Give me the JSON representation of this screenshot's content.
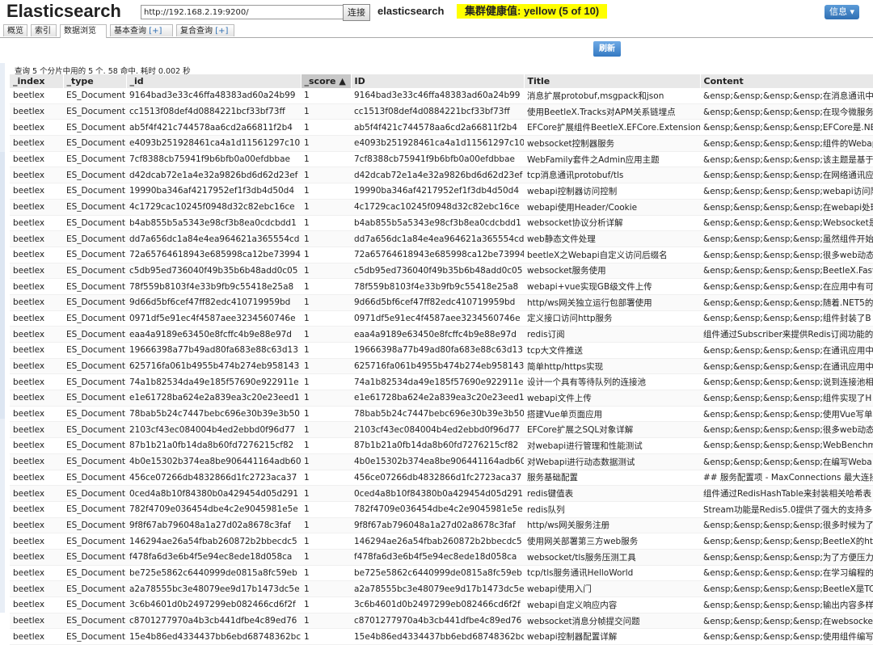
{
  "header": {
    "app_title": "Elasticsearch",
    "url": "http://192.168.2.19:9200/",
    "connect_label": "连接",
    "cluster_name": "elasticsearch",
    "health_label": "集群健康值: yellow (5 of 10)",
    "info_label": "信息 ▾"
  },
  "tabs": [
    {
      "label": "概览",
      "plus": ""
    },
    {
      "label": "索引",
      "plus": ""
    },
    {
      "label": "数据浏览",
      "plus": ""
    },
    {
      "label": "基本查询 ",
      "plus": "[+]"
    },
    {
      "label": "复合查询 ",
      "plus": "[+]"
    }
  ],
  "toolbar": {
    "refresh_label": "刷新"
  },
  "query_summary": "查询 5 个分片中用的 5 个. 58 命中. 耗时 0.002 秒",
  "columns": [
    "_index",
    "_type",
    "_id",
    "_score ▲",
    "ID",
    "Title",
    "Content"
  ],
  "rows": [
    [
      "beetlex",
      "ES_Document",
      "9164bad3e33c46ffa48383ad60a24b99",
      "1",
      "9164bad3e33c46ffa48383ad60a24b99",
      "消息扩展protobuf,msgpack和json",
      "&ensp;&ensp;&ensp;&ensp;在消息通讯中"
    ],
    [
      "beetlex",
      "ES_Document",
      "cc1513f08def4d0884221bcf33bf73ff",
      "1",
      "cc1513f08def4d0884221bcf33bf73ff",
      "使用BeetleX.Tracks对APM关系链埋点",
      "&ensp;&ensp;&ensp;&ensp;在现今微服务"
    ],
    [
      "beetlex",
      "ES_Document",
      "ab5f4f421c744578aa6cd2a66811f2b4",
      "1",
      "ab5f4f421c744578aa6cd2a66811f2b4",
      "EFCore扩展组件BeetleX.EFCore.Extension",
      "&ensp;&ensp;&ensp;&ensp;EFCore是.NE"
    ],
    [
      "beetlex",
      "ES_Document",
      "e4093b251928461ca4a1d11561297c10",
      "1",
      "e4093b251928461ca4a1d11561297c10",
      "websocket控制器服务",
      "&ensp;&ensp;&ensp;&ensp;组件的Webapi"
    ],
    [
      "beetlex",
      "ES_Document",
      "7cf8388cb75941f9b6bfb0a00efdbbae",
      "1",
      "7cf8388cb75941f9b6bfb0a00efdbbae",
      "WebFamily套件之Admin应用主题",
      "&ensp;&ensp;&ensp;&ensp;该主题是基于"
    ],
    [
      "beetlex",
      "ES_Document",
      "d42dcab72e1a4e32a9826bd6d62d23ef",
      "1",
      "d42dcab72e1a4e32a9826bd6d62d23ef",
      "tcp消息通讯protobuf/tls",
      "&ensp;&ensp;&ensp;&ensp;在网络通讯应"
    ],
    [
      "beetlex",
      "ES_Document",
      "19990ba346af4217952ef1f3db4d50d4",
      "1",
      "19990ba346af4217952ef1f3db4d50d4",
      "webapi控制器访问控制",
      "&ensp;&ensp;&ensp;&ensp;webapi访问限"
    ],
    [
      "beetlex",
      "ES_Document",
      "4c1729cac10245f0948d32c82ebc16ce",
      "1",
      "4c1729cac10245f0948d32c82ebc16ce",
      "webapi使用Header/Cookie",
      "&ensp;&ensp;&ensp;&ensp;在webapi处理"
    ],
    [
      "beetlex",
      "ES_Document",
      "b4ab855b5a5343e98cf3b8ea0cdcbdd1",
      "1",
      "b4ab855b5a5343e98cf3b8ea0cdcbdd1",
      "websocket协议分析详解",
      "&ensp;&ensp;&ensp;&ensp;Websocket是"
    ],
    [
      "beetlex",
      "ES_Document",
      "dd7a656dc1a84e4ea964621a365554cd",
      "1",
      "dd7a656dc1a84e4ea964621a365554cd",
      "web静态文件处理",
      "&ensp;&ensp;&ensp;&ensp;虽然组件开始"
    ],
    [
      "beetlex",
      "ES_Document",
      "72a65764618943e685998ca12be73994",
      "1",
      "72a65764618943e685998ca12be73994",
      "beetleX之Webapi自定义访问后缀名",
      "&ensp;&ensp;&ensp;&ensp;很多web动态"
    ],
    [
      "beetlex",
      "ES_Document",
      "c5db95ed736040f49b35b6b48add0c05",
      "1",
      "c5db95ed736040f49b35b6b48add0c05",
      "websocket服务使用",
      "&ensp;&ensp;&ensp;&ensp;BeetleX.Fast"
    ],
    [
      "beetlex",
      "ES_Document",
      "78f559b8103f4e33b9fb9c55418e25a8",
      "1",
      "78f559b8103f4e33b9fb9c55418e25a8",
      "webapi+vue实现GB级文件上传",
      "&ensp;&ensp;&ensp;&ensp;在应用中有可"
    ],
    [
      "beetlex",
      "ES_Document",
      "9d66d5bf6cef47ff82edc410719959bd",
      "1",
      "9d66d5bf6cef47ff82edc410719959bd",
      "http/ws网关独立运行包部署使用",
      "&ensp;&ensp;&ensp;&ensp;随着.NET5的"
    ],
    [
      "beetlex",
      "ES_Document",
      "0971df5e91ec4f4587aee3234560746e",
      "1",
      "0971df5e91ec4f4587aee3234560746e",
      "定义接口访问http服务",
      "&ensp;&ensp;&ensp;&ensp;组件封装了B"
    ],
    [
      "beetlex",
      "ES_Document",
      "eaa4a9189e63450e8fcffc4b9e88e97d",
      "1",
      "eaa4a9189e63450e8fcffc4b9e88e97d",
      "redis订阅",
      "组件通过Subscriber来提供Redis订阅功能的"
    ],
    [
      "beetlex",
      "ES_Document",
      "19666398a77b49ad80fa683e88c63d13",
      "1",
      "19666398a77b49ad80fa683e88c63d13",
      "tcp大文件推送",
      "&ensp;&ensp;&ensp;&ensp;在通讯应用中"
    ],
    [
      "beetlex",
      "ES_Document",
      "625716fa061b4955b474b274eb958143",
      "1",
      "625716fa061b4955b474b274eb958143",
      "简单http/https实现",
      "&ensp;&ensp;&ensp;&ensp;在通讯应用中"
    ],
    [
      "beetlex",
      "ES_Document",
      "74a1b82534da49e185f57690e922911e",
      "1",
      "74a1b82534da49e185f57690e922911e",
      "设计一个具有等待队列的连接池",
      "&ensp;&ensp;&ensp;&ensp;说到连接池相"
    ],
    [
      "beetlex",
      "ES_Document",
      "e1e61728ba624e2a839ea3c20e23eed1",
      "1",
      "e1e61728ba624e2a839ea3c20e23eed1",
      "webapi文件上传",
      "&ensp;&ensp;&ensp;&ensp;组件实现了H"
    ],
    [
      "beetlex",
      "ES_Document",
      "78bab5b24c7447bebc696e30b39e3b50",
      "1",
      "78bab5b24c7447bebc696e30b39e3b50",
      "搭建Vue单页面应用",
      "&ensp;&ensp;&ensp;&ensp;使用Vue写单"
    ],
    [
      "beetlex",
      "ES_Document",
      "2103cf43ec084004b4ed2ebbd0f96d77",
      "1",
      "2103cf43ec084004b4ed2ebbd0f96d77",
      "EFCore扩展之SQL对象详解",
      "&ensp;&ensp;&ensp;&ensp;很多web动态"
    ],
    [
      "beetlex",
      "ES_Document",
      "87b1b21a0fb14da8b60fd7276215cf82",
      "1",
      "87b1b21a0fb14da8b60fd7276215cf82",
      "对webapi进行管理和性能测试",
      "&ensp;&ensp;&ensp;&ensp;WebBenchm"
    ],
    [
      "beetlex",
      "ES_Document",
      "4b0e15302b374ea8be906441164adb60",
      "1",
      "4b0e15302b374ea8be906441164adb60",
      "对Webapi进行动态数据测试",
      "&ensp;&ensp;&ensp;&ensp;在编写Weba"
    ],
    [
      "beetlex",
      "ES_Document",
      "456ce07266db4832866d1fc2723aca37",
      "1",
      "456ce07266db4832866d1fc2723aca37",
      "服务基础配置",
      "## 服务配置项 - MaxConnections 最大连接"
    ],
    [
      "beetlex",
      "ES_Document",
      "0ced4a8b10f84380b0a429454d05d291",
      "1",
      "0ced4a8b10f84380b0a429454d05d291",
      "redis键值表",
      "组件通过RedisHashTable来封装相关哈希表"
    ],
    [
      "beetlex",
      "ES_Document",
      "782f4709e036454dbe4c2e9045981e5e",
      "1",
      "782f4709e036454dbe4c2e9045981e5e",
      "redis队列",
      "Stream功能是Redis5.0提供了强大的支持多"
    ],
    [
      "beetlex",
      "ES_Document",
      "9f8f67ab796048a1a27d02a8678c3faf",
      "1",
      "9f8f67ab796048a1a27d02a8678c3faf",
      "http/ws网关服务注册",
      "&ensp;&ensp;&ensp;&ensp;很多时候为了"
    ],
    [
      "beetlex",
      "ES_Document",
      "146294ae26a54fbab260872b2bbecdc5",
      "1",
      "146294ae26a54fbab260872b2bbecdc5",
      "使用网关部署第三方web服务",
      "&ensp;&ensp;&ensp;&ensp;BeetleX的ht"
    ],
    [
      "beetlex",
      "ES_Document",
      "f478fa6d3e6b4f5e94ec8ede18d058ca",
      "1",
      "f478fa6d3e6b4f5e94ec8ede18d058ca",
      "websocket/tls服务压测工具",
      "&ensp;&ensp;&ensp;&ensp;为了方便压力"
    ],
    [
      "beetlex",
      "ES_Document",
      "be725e5862c6440999de0815a8fc59eb",
      "1",
      "be725e5862c6440999de0815a8fc59eb",
      "tcp/tls服务通讯HelloWorld",
      "&ensp;&ensp;&ensp;&ensp;在学习编程的"
    ],
    [
      "beetlex",
      "ES_Document",
      "a2a78555bc3e48079ee9d17b1473dc5e",
      "1",
      "a2a78555bc3e48079ee9d17b1473dc5e",
      "webapi使用入门",
      "&ensp;&ensp;&ensp;&ensp;BeetleX是TC"
    ],
    [
      "beetlex",
      "ES_Document",
      "3c6b4601d0b2497299eb082466cd6f2f",
      "1",
      "3c6b4601d0b2497299eb082466cd6f2f",
      "webapi自定义响应内容",
      "&ensp;&ensp;&ensp;&ensp;输出内容多样"
    ],
    [
      "beetlex",
      "ES_Document",
      "c8701277970a4b3cb441dfbe4c89ed76",
      "1",
      "c8701277970a4b3cb441dfbe4c89ed76",
      "websocket消息分帧提交问题",
      "&ensp;&ensp;&ensp;&ensp;在websocket"
    ],
    [
      "beetlex",
      "ES_Document",
      "15e4b86ed4334437bb6ebd68748362bc",
      "1",
      "15e4b86ed4334437bb6ebd68748362bc",
      "webapi控制器配置详解",
      "&ensp;&ensp;&ensp;&ensp;使用组件编写"
    ]
  ]
}
